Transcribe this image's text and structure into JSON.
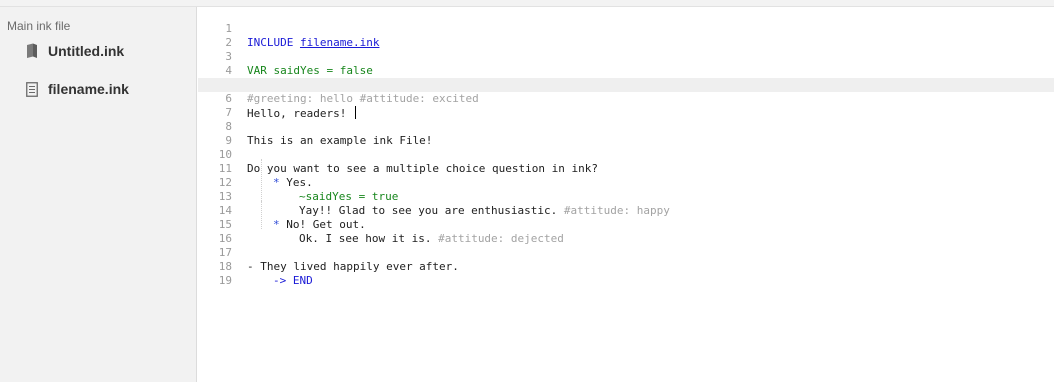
{
  "sidebar": {
    "header": "Main ink file",
    "files": [
      {
        "label": "Untitled.ink",
        "icon": "book-icon"
      },
      {
        "label": "filename.ink",
        "icon": "document-icon"
      }
    ]
  },
  "editor": {
    "line_numbers": [
      "1",
      "2",
      "3",
      "4",
      "5",
      "6",
      "7",
      "8",
      "9",
      "10",
      "11",
      "12",
      "13",
      "14",
      "15",
      "16",
      "17",
      "18",
      "19"
    ],
    "lines": {
      "l1_kw": "INCLUDE",
      "l1_link": "filename.ink",
      "l3": "VAR saidYes = false",
      "l5": "#greeting: hello #attitude: excited",
      "l6": "Hello, readers! ",
      "l8": "This is an example ink File!",
      "l10": "Do you want to see a multiple choice question in ink?",
      "l11_bullet": "*",
      "l11_text": " Yes.",
      "l12": "~saidYes = true",
      "l13_text": "Yay!! Glad to see you are enthusiastic. ",
      "l13_tag": "#attitude: happy",
      "l14_bullet": "*",
      "l14_text": " No! Get out.",
      "l15_text": "Ok. I see how it is. ",
      "l15_tag": "#attitude: dejected",
      "l17": "- They lived happily ever after.",
      "l18_arrow": "->",
      "l18_end": "END"
    }
  },
  "colors": {
    "keyword": "#1a1ad6",
    "string_green": "#17861c",
    "tag_gray": "#a3a3a3",
    "active_line": "#efefef"
  }
}
